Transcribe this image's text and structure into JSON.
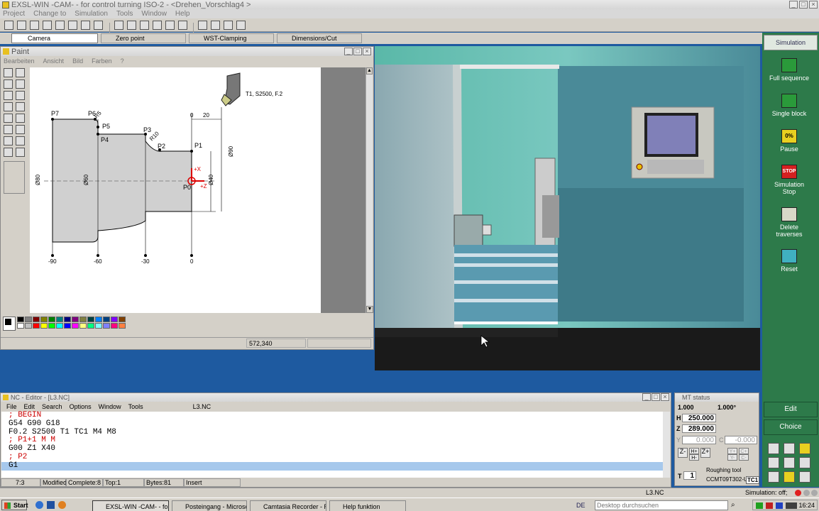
{
  "app": {
    "title": "EXSL-WIN -CAM- - for control turning ISO-2 - <Drehen_Vorschlag4 >",
    "menu": [
      "Project",
      "Change to",
      "Simulation",
      "Tools",
      "Window",
      "Help"
    ]
  },
  "tabs": [
    "Camera",
    "Zero point",
    "WST-Clamping",
    "Dimensions/Cut"
  ],
  "paint": {
    "title": "Paint",
    "menu": [
      "Bearbeiten",
      "Ansicht",
      "Bild",
      "Farben",
      "?"
    ],
    "status_coords": "572,340",
    "tool_label": "T1, S2500, F.2",
    "points": [
      "P7",
      "P6",
      "P5",
      "P4",
      "P3",
      "P2",
      "P1",
      "P0"
    ],
    "dims": {
      "r5": "R5",
      "r10": "R10",
      "d80": "Ø80",
      "d60": "Ø60",
      "d40": "Ø40",
      "d90": "Ø90",
      "dx0": "0",
      "dx20": "20"
    },
    "axis_x": "+X",
    "axis_z": "+Z",
    "x_ticks": [
      "-90",
      "-60",
      "-30",
      "0"
    ],
    "palette": [
      "#000000",
      "#808080",
      "#800000",
      "#808000",
      "#008000",
      "#008080",
      "#000080",
      "#800080",
      "#808040",
      "#004040",
      "#0080ff",
      "#004080",
      "#8000ff",
      "#804000",
      "#ffffff",
      "#c0c0c0",
      "#ff0000",
      "#ffff00",
      "#00ff00",
      "#00ffff",
      "#0000ff",
      "#ff00ff",
      "#ffff80",
      "#00ff80",
      "#80ffff",
      "#8080ff",
      "#ff0080",
      "#ff8040"
    ]
  },
  "sidebar": {
    "header": "Simulation",
    "items": [
      {
        "label": "Full sequence",
        "color": "#2a9a3a"
      },
      {
        "label": "Single block",
        "color": "#2a9a3a"
      },
      {
        "label": "Pause",
        "color": "#e8d020",
        "icon_text": "0%"
      },
      {
        "label": "Simulation Stop",
        "color": "#d42020",
        "icon_text": "STOP"
      },
      {
        "label": "Delete traverses",
        "color": "#d8d8c8"
      },
      {
        "label": "Reset",
        "color": "#40b0c0"
      }
    ],
    "edit_label": "Edit",
    "choice_label": "Choice"
  },
  "editor": {
    "title": "NC - Editor - [L3.NC]",
    "menu": [
      "File",
      "Edit",
      "Search",
      "Options",
      "Window",
      "Tools"
    ],
    "file_tab": "L3.NC",
    "lines": [
      {
        "text": "; BEGIN",
        "comment": true
      },
      {
        "text": "G54 G90 G18",
        "comment": false
      },
      {
        "text": "F0.2 S2500 T1 TC1 M4 M8",
        "comment": false
      },
      {
        "text": "; P1+1 M M",
        "comment": true
      },
      {
        "text": "G00 Z1 X40",
        "comment": false
      },
      {
        "text": "; P2",
        "comment": true
      },
      {
        "text": "G1",
        "comment": false,
        "selected": true
      }
    ],
    "status": [
      "7:3",
      "Modified",
      "Complete:8",
      "Top:1",
      "Bytes:81",
      "Insert"
    ]
  },
  "mt_status": {
    "title": "MT status",
    "factor1": "1.000",
    "factor2": "1.000°",
    "h_label": "H",
    "h_value": "250.000",
    "z_label": "Z",
    "z_value": "289.000",
    "y_label": "Y",
    "y_value": "0.000",
    "c_label": "C",
    "c_value": "-0.000",
    "t_label": "T",
    "t_value": "1",
    "tool_name": "Roughing tool",
    "tool_code": "CCMT09T302-U",
    "tc_label": "TC1",
    "btn_zminus": "Z-",
    "btn_hplus": "H+",
    "btn_hminus": "H-",
    "btn_zplus": "Z+",
    "btn_yplus": "Y+",
    "btn_cplus": "C+",
    "btn_yminus": "Y-",
    "btn_cminus": "C-"
  },
  "statusbar": {
    "file": "L3.NC",
    "simulation": "Simulation: off;"
  },
  "taskbar": {
    "start": "Start",
    "items": [
      "EXSL-WIN -CAM- - for ...",
      "Posteingang - Microsoft ...",
      "Camtasia Recorder - Rec...",
      "Help funktion"
    ],
    "lang": "DE",
    "search_placeholder": "Desktop durchsuchen",
    "time": "16:24"
  }
}
